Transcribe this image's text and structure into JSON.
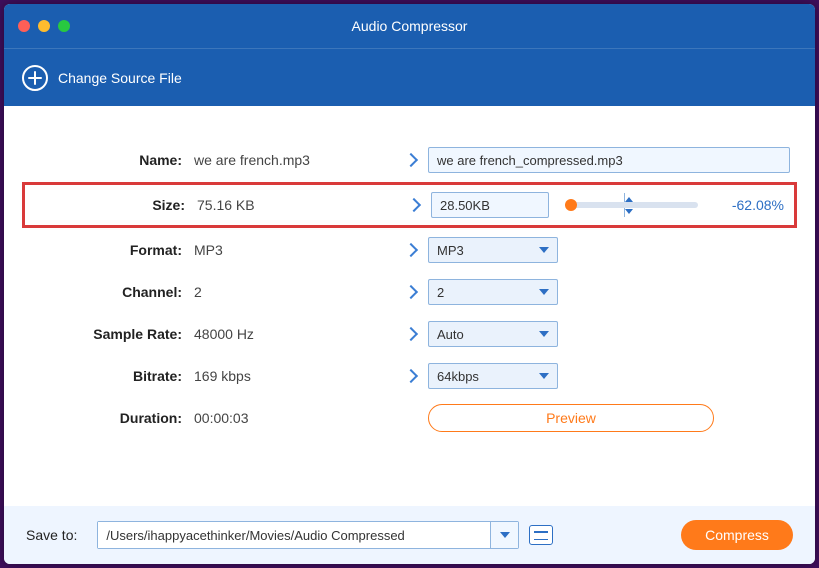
{
  "window": {
    "title": "Audio Compressor"
  },
  "subheader": {
    "change_source": "Change Source File"
  },
  "rows": {
    "name": {
      "label": "Name:",
      "src": "we are french.mp3",
      "out": "we are french_compressed.mp3"
    },
    "size": {
      "label": "Size:",
      "src": "75.16 KB",
      "out": "28.50KB",
      "delta": "-62.08%"
    },
    "format": {
      "label": "Format:",
      "src": "MP3",
      "out": "MP3"
    },
    "channel": {
      "label": "Channel:",
      "src": "2",
      "out": "2"
    },
    "sample_rate": {
      "label": "Sample Rate:",
      "src": "48000 Hz",
      "out": "Auto"
    },
    "bitrate": {
      "label": "Bitrate:",
      "src": "169 kbps",
      "out": "64kbps"
    },
    "duration": {
      "label": "Duration:",
      "src": "00:00:03"
    }
  },
  "preview": {
    "label": "Preview"
  },
  "footer": {
    "save_to_label": "Save to:",
    "path": "/Users/ihappyacethinker/Movies/Audio Compressed",
    "compress_label": "Compress"
  }
}
